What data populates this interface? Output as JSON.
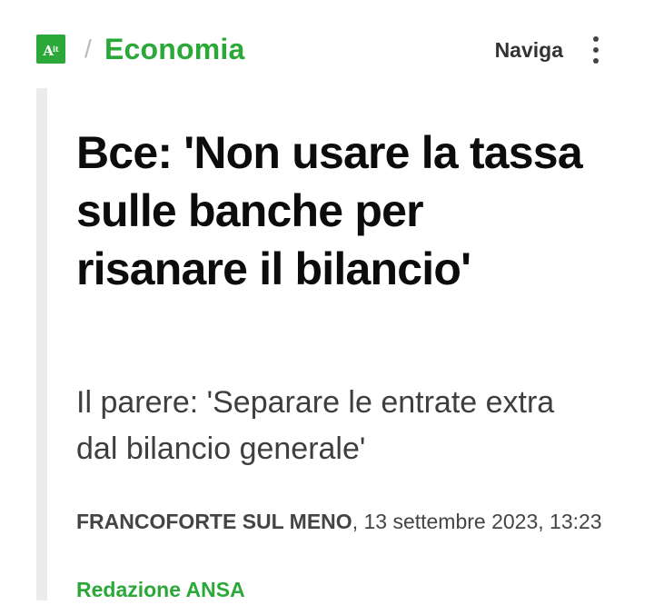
{
  "header": {
    "logo_text": "A",
    "logo_sub": "it",
    "separator": "/",
    "section": "Economia",
    "nav_label": "Naviga"
  },
  "article": {
    "headline": "Bce: 'Non usare la tassa sulle banche per risanare il bilancio'",
    "subtitle": "Il parere: 'Separare le entrate extra dal bilancio generale'",
    "place": "FRANCOFORTE SUL MENO",
    "date": ", 13 settembre 2023, 13:23",
    "author": "Redazione ANSA"
  },
  "colors": {
    "brand_green": "#2aa838",
    "text_dark": "#0c0c0c",
    "text_gray": "#3e3e3e",
    "bar_gray": "#ececec"
  },
  "icons": {
    "logo": "ansa-logo-icon",
    "menu": "kebab-menu-icon"
  }
}
